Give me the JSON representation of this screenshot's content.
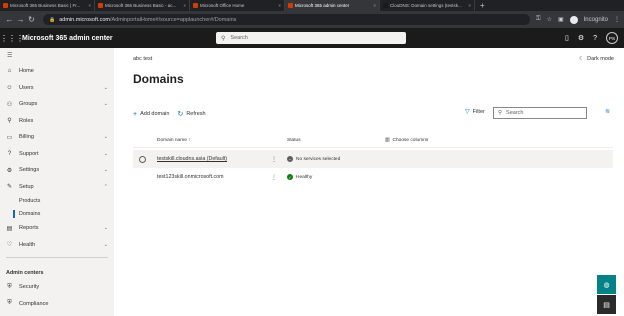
{
  "browser": {
    "tabs": [
      {
        "title": "Microsoft 365 Business Basic | Fr...",
        "color": "#d83b01",
        "active": false
      },
      {
        "title": "Microsoft 365 Business Basic - ac...",
        "color": "#d83b01",
        "active": false
      },
      {
        "title": "Microsoft Office Home",
        "color": "#d83b01",
        "active": false
      },
      {
        "title": "Microsoft 365 admin center",
        "color": "#d83b01",
        "active": true
      },
      {
        "title": "ClouDNS: Domain settings (testsk...",
        "color": "#1a1a1a",
        "active": false
      }
    ],
    "new_tab": "+",
    "url_host": "admin.microsoft.com",
    "url_path": "/AdminportalHome#/source=applauncher#/Domains",
    "profile": "Incognito"
  },
  "header": {
    "app_title": "Microsoft 365 admin center",
    "search_placeholder": "Search",
    "avatar": "PS"
  },
  "sidebar": {
    "items": [
      {
        "label": "Home",
        "icon": "⌂",
        "chevron": ""
      },
      {
        "label": "Users",
        "icon": "☺",
        "chevron": "⌄"
      },
      {
        "label": "Groups",
        "icon": "⚇",
        "chevron": "⌄"
      },
      {
        "label": "Roles",
        "icon": "⚲",
        "chevron": ""
      },
      {
        "label": "Billing",
        "icon": "▭",
        "chevron": "⌄"
      },
      {
        "label": "Support",
        "icon": "?",
        "chevron": "⌄"
      },
      {
        "label": "Settings",
        "icon": "⚙",
        "chevron": "⌄"
      },
      {
        "label": "Setup",
        "icon": "✎",
        "chevron": "⌃"
      }
    ],
    "setup_sub": [
      {
        "label": "Products",
        "active": false
      },
      {
        "label": "Domains",
        "active": true
      }
    ],
    "items2": [
      {
        "label": "Reports",
        "icon": "▤",
        "chevron": "⌄"
      },
      {
        "label": "Health",
        "icon": "♡",
        "chevron": "⌄"
      }
    ],
    "section_title": "Admin centers",
    "admin_centers": [
      {
        "label": "Security",
        "icon": "⛨"
      },
      {
        "label": "Compliance",
        "icon": "⛨"
      }
    ]
  },
  "main": {
    "org_name": "abc test",
    "dark_mode": "Dark mode",
    "title": "Domains",
    "add_domain": "Add domain",
    "refresh": "Refresh",
    "filter": "Filter",
    "search_placeholder": "Search",
    "columns": {
      "name": "Domain name ↑",
      "status": "Status",
      "choose": "Choose columns"
    },
    "rows": [
      {
        "name": "testskill.cloudns.asia (Default)",
        "status": "No services selected",
        "status_color": "#605e5c",
        "status_glyph": "−",
        "selected": true
      },
      {
        "name": "test123skill.onmicrosoft.com",
        "status": "Healthy",
        "status_color": "#107c10",
        "status_glyph": "✓",
        "selected": false
      }
    ]
  }
}
